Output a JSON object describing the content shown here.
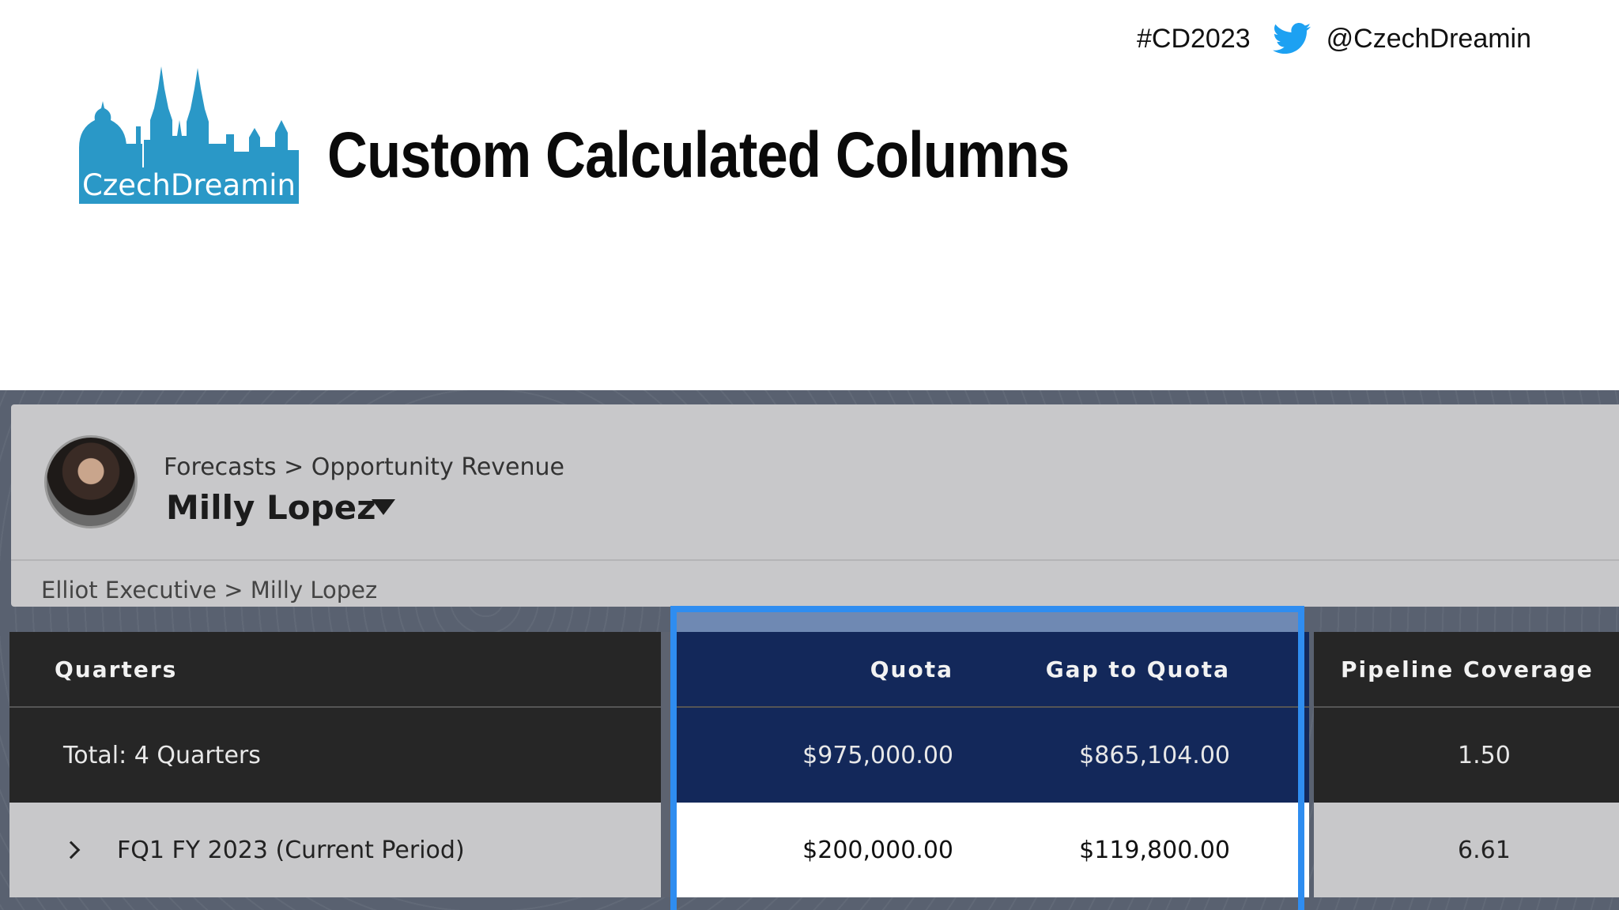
{
  "social": {
    "hashtag": "#CD2023",
    "handle": "@CzechDreamin",
    "icon": "twitter-bird-icon"
  },
  "logo": {
    "text": "CzechDreamin",
    "color": "#2a98c7"
  },
  "slide": {
    "title": "Custom Calculated Columns"
  },
  "forecast": {
    "breadcrumb": "Forecasts > Opportunity Revenue",
    "owner_name": "Milly Lopez",
    "hierarchy": "Elliot Executive > Milly Lopez",
    "columns": {
      "quarters": "Quarters",
      "quota": "Quota",
      "gap_to_quota": "Gap to Quota",
      "pipeline_coverage": "Pipeline Coverage"
    },
    "rows": [
      {
        "label": "Total: 4 Quarters",
        "quota": "$975,000.00",
        "gap_to_quota": "$865,104.00",
        "pipeline_coverage": "1.50"
      },
      {
        "label": "FQ1 FY 2023 (Current Period)",
        "quota": "$200,000.00",
        "gap_to_quota": "$119,800.00",
        "pipeline_coverage": "6.61"
      }
    ],
    "highlight_color": "#2f8df0",
    "header_color": "#13285a"
  }
}
